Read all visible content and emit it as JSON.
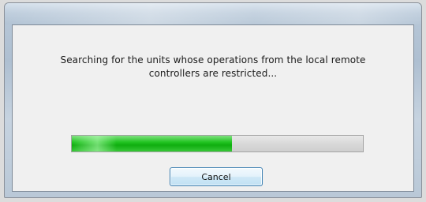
{
  "dialog": {
    "message_line1": "Searching for the units whose operations from the local remote",
    "message_line2": "controllers are restricted...",
    "progress_fraction": 0.55,
    "cancel_label": "Cancel"
  }
}
